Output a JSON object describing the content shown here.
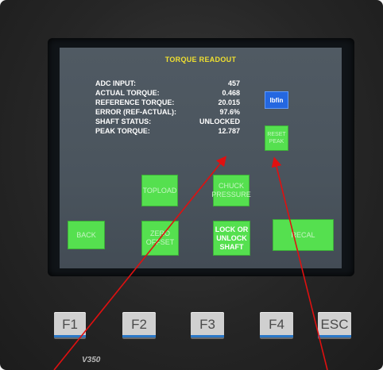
{
  "screen": {
    "title": "TORQUE READOUT",
    "rows": [
      {
        "label": "ADC INPUT:",
        "value": "457"
      },
      {
        "label": "ACTUAL TORQUE:",
        "value": "0.468"
      },
      {
        "label": "REFERENCE TORQUE:",
        "value": "20.015"
      },
      {
        "label": "ERROR (REF-ACTUAL):",
        "value": "97.6%"
      },
      {
        "label": "SHAFT STATUS:",
        "value": "UNLOCKED"
      },
      {
        "label": "PEAK TORQUE:",
        "value": "12.787"
      }
    ],
    "unit_button": "lbfin",
    "buttons": {
      "reset_peak": "RESET\nPEAK",
      "topload": "TOPLOAD",
      "chuck_pressure": "CHUCK\nPRESSURE",
      "back": "BACK",
      "zero_offset": "ZERO\nOFFSET",
      "lock_unlock": "LOCK OR\nUNLOCK\nSHAFT",
      "recal": "RECAL"
    }
  },
  "keys": [
    "F1",
    "F2",
    "F3",
    "F4",
    "ESC"
  ],
  "model": "V350",
  "colors": {
    "screen_bg": "#4a545d",
    "title": "#f0e030",
    "button_green": "#55e04f",
    "unit_blue": "#2467e0",
    "annotation_arrow": "#e01010"
  }
}
